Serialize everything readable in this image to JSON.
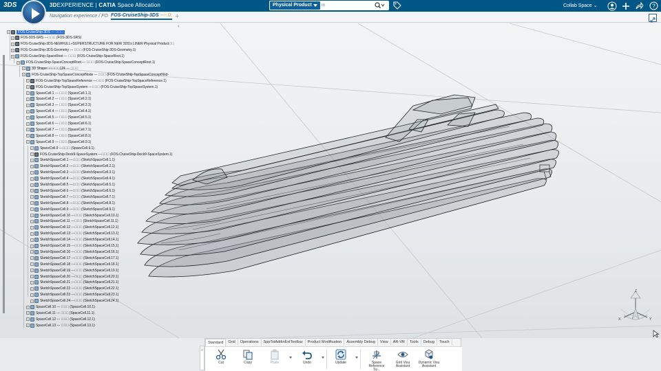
{
  "app": {
    "brand_prefix": "3D",
    "brand_experience": "EXPERIENCE",
    "brand_product": "CATIA",
    "brand_app": "Space Allocation",
    "logo_text": "3DS"
  },
  "search": {
    "scope": "Physical Product",
    "placeholder": "In"
  },
  "topbar": {
    "collab_space": "Collab Space",
    "icons": [
      "user-icon",
      "add-icon",
      "share-icon",
      "help-icon"
    ]
  },
  "tabs": {
    "nav_label": "Navigation experience / FO",
    "active_label": "FOS-CruiseShip-3DS",
    "active_suffix": "----.0:",
    "add_label": "+"
  },
  "tree": {
    "collapse_glyph": "‹",
    "nodes": [
      {
        "label": "FOS-CruiseShip-3DS --- ᷍᷍᷍",
        "level": 0,
        "icon": "prod",
        "selected": true
      },
      {
        "label": "FOS-3DS-SRS ---᷍᷍᷍ (FOS-3DS-SRS)",
        "level": 1,
        "icon": "prod"
      },
      {
        "label": "FOS-CruiseShip-3DS-NEWHULL+SUPERSTRUCTURE FOR NEW 3DS's LINER Physical Product᷍᷍",
        "level": 1,
        "icon": "prod"
      },
      {
        "label": "FOS-CruiseShip-3DS-Geometry --- ᷍᷍᷍ (FOS-CruiseShip-3DS-Geometry.1)",
        "level": 1,
        "icon": "prod"
      },
      {
        "label": "FOS-CruiseShip-SpaceRoot --- ᷍᷍᷍ (FOS-CruiseShip-SpaceRoot.1)",
        "level": 1,
        "icon": "cell"
      },
      {
        "label": "FOS-CruiseShip-SpaceConceptRoot --- ᷍᷍᷍ (FOS-CruiseShip-SpaceConceptRoot.1)",
        "level": 2,
        "icon": "cell"
      },
      {
        "label": "3D Shape᷍᷍᷍᷍᷍124 --- ᷍᷍᷍",
        "level": 3,
        "icon": "cell"
      },
      {
        "label": "FOS-CruiseShip-TopSpaceConceptNode --- ᷍᷍᷍ (FOS-CruiseShip-TopSpaceConceptNod-",
        "level": 3,
        "icon": "cell"
      },
      {
        "label": "FOS-CruiseShip-TopSpaceReference ---᷍᷍᷍ (FOS-CruiseShip-TopSpaceReference.1)",
        "level": 4,
        "icon": "prod"
      },
      {
        "label": "FOS-CruiseShip-TopSpaceSystem ---᷍᷍᷍ (FOS-CruiseShip-TopSpaceSystem.1)",
        "level": 4,
        "icon": "prod"
      },
      {
        "label": "SpaceCell.1 --- ᷍᷍᷍ (SpaceCell.1.1)",
        "level": 4,
        "icon": "cell"
      },
      {
        "label": "SpaceCell.2 --- ᷍᷍᷍ (SpaceCell.2.1)",
        "level": 4,
        "icon": "cell"
      },
      {
        "label": "SpaceCell.3 --- ᷍᷍᷍ (SpaceCell.3.1)",
        "level": 4,
        "icon": "cell"
      },
      {
        "label": "SpaceCell.4 --- ᷍᷍᷍ (SpaceCell.4.1)",
        "level": 4,
        "icon": "cell"
      },
      {
        "label": "SpaceCell.5 --- ᷍᷍᷍ (SpaceCell.5.1)",
        "level": 4,
        "icon": "cell"
      },
      {
        "label": "SpaceCell.6 --- ᷍᷍᷍ (SpaceCell.6.1)",
        "level": 4,
        "icon": "cell"
      },
      {
        "label": "SpaceCell.7 --- ᷍᷍᷍ (SpaceCell.7.1)",
        "level": 4,
        "icon": "cell"
      },
      {
        "label": "SpaceCell.8 --- ᷍᷍᷍ (SpaceCell.8.1)",
        "level": 4,
        "icon": "cell"
      },
      {
        "label": "SpaceCell.9 --- ᷍᷍᷍ (SpaceCell.9.1)",
        "level": 4,
        "icon": "cell"
      },
      {
        "label": "SpaceCell.9 ---᷍᷍᷍ (SpaceCell.9.1)",
        "level": 5,
        "icon": "cell"
      },
      {
        "label": "FOS-CruiseShip-Deck9-SpaceSystem ---᷍᷍᷍ (FOS-CruiseShip-Deck9-SpaceSystem.1)",
        "level": 5,
        "icon": "prod"
      },
      {
        "label": "SketchSpaceCell.1 ---᷍᷍᷍ (SketchSpaceCell.1.1)",
        "level": 5,
        "icon": "cell"
      },
      {
        "label": "SketchSpaceCell.2 ---᷍᷍᷍ (SketchSpaceCell.2.1)",
        "level": 5,
        "icon": "cell"
      },
      {
        "label": "SketchSpaceCell.3 ---᷍᷍᷍ (SketchSpaceCell.3.1)",
        "level": 5,
        "icon": "cell"
      },
      {
        "label": "SketchSpaceCell.4 ---᷍᷍᷍ (SketchSpaceCell.4.1)",
        "level": 5,
        "icon": "cell"
      },
      {
        "label": "SketchSpaceCell.5 ---᷍᷍᷍ (SketchSpaceCell.5.1)",
        "level": 5,
        "icon": "cell"
      },
      {
        "label": "SketchSpaceCell.6 ---᷍᷍᷍ (SketchSpaceCell.6.1)",
        "level": 5,
        "icon": "cell"
      },
      {
        "label": "SketchSpaceCell.7 ---᷍᷍᷍ (SketchSpaceCell.7.1)",
        "level": 5,
        "icon": "cell"
      },
      {
        "label": "SketchSpaceCell.8 ---᷍᷍᷍ (SketchSpaceCell.8.1)",
        "level": 5,
        "icon": "cell"
      },
      {
        "label": "SketchSpaceCell.9 ---᷍᷍᷍ (SketchSpaceCell.9.1)",
        "level": 5,
        "icon": "cell"
      },
      {
        "label": "SketchSpaceCell.10 ---᷍᷍᷍ (SketchSpaceCell.10.1)",
        "level": 5,
        "icon": "cell"
      },
      {
        "label": "SketchSpaceCell.11 ---᷍᷍᷍ (SketchSpaceCell.11.1)",
        "level": 5,
        "icon": "cell"
      },
      {
        "label": "SketchSpaceCell.12 ---᷍᷍᷍ (SketchSpaceCell.12.1)",
        "level": 5,
        "icon": "cell"
      },
      {
        "label": "SketchSpaceCell.13 ---᷍᷍᷍ (SketchSpaceCell.13.1)",
        "level": 5,
        "icon": "cell"
      },
      {
        "label": "SketchSpaceCell.14 ---᷍᷍᷍ (SketchSpaceCell.14.1)",
        "level": 5,
        "icon": "cell"
      },
      {
        "label": "SketchSpaceCell.15 ---᷍᷍᷍ (SketchSpaceCell.15.1)",
        "level": 5,
        "icon": "cell"
      },
      {
        "label": "SketchSpaceCell.16 ---᷍᷍᷍ (SketchSpaceCell.16.1)",
        "level": 5,
        "icon": "cell"
      },
      {
        "label": "SketchSpaceCell.17 ---᷍᷍᷍ (SketchSpaceCell.17.1)",
        "level": 5,
        "icon": "cell"
      },
      {
        "label": "SketchSpaceCell.18 ---᷍᷍᷍ (SketchSpaceCell.18.1)",
        "level": 5,
        "icon": "cell"
      },
      {
        "label": "SketchSpaceCell.19 ---᷍᷍᷍ (SketchSpaceCell.19.1)",
        "level": 5,
        "icon": "cell"
      },
      {
        "label": "SketchSpaceCell.20 ---᷍᷍᷍ (SketchSpaceCell.20.1)",
        "level": 5,
        "icon": "cell"
      },
      {
        "label": "SketchSpaceCell.21 ---᷍᷍᷍ (SketchSpaceCell.21.1)",
        "level": 5,
        "icon": "cell"
      },
      {
        "label": "SketchSpaceCell.22 ---᷍᷍᷍ (SketchSpaceCell.22.1)",
        "level": 5,
        "icon": "cell"
      },
      {
        "label": "SketchSpaceCell.23 ---᷍᷍᷍ (SketchSpaceCell.23.1)",
        "level": 5,
        "icon": "cell"
      },
      {
        "label": "SketchSpaceCell.24 ---᷍᷍᷍ (SketchSpaceCell.24.1)",
        "level": 5,
        "icon": "cell"
      },
      {
        "label": "SpaceCell.10 --- ᷍᷍᷍ (SpaceCell.10.1)",
        "level": 4,
        "icon": "cell"
      },
      {
        "label": "SpaceCell.11 --- ᷍᷍᷍ (SpaceCell.11.1)",
        "level": 4,
        "icon": "cell"
      },
      {
        "label": "SpaceCell.12 --- ᷍᷍᷍ (SpaceCell.12.1)",
        "level": 4,
        "icon": "cell"
      },
      {
        "label": "SpaceCell.13 --- ᷍᷍᷍ (SpaceCell.13.1)",
        "level": 4,
        "icon": "cell"
      }
    ]
  },
  "compass": {
    "z": "Z",
    "x": "X",
    "y": "Y"
  },
  "actionbar": {
    "tabs": [
      "Standard",
      "Grid",
      "Operations",
      "SppTstAddinExtToolbar",
      "Product Modification",
      "Assembly Debug",
      "View",
      "AR-VR",
      "Tools",
      "Debug",
      "Touch"
    ],
    "active_tab": "Standard",
    "side_glyph": "⌄",
    "commands": [
      {
        "label": "Cut",
        "icon": "scissors-icon",
        "disabled": false
      },
      {
        "label": "Copy",
        "icon": "copy-icon",
        "disabled": false
      },
      {
        "label": "Paste",
        "icon": "paste-icon",
        "disabled": true
      },
      {
        "label": "Undo",
        "icon": "undo-icon",
        "disabled": false
      },
      {
        "label": "Update",
        "icon": "update-icon",
        "disabled": false
      },
      {
        "label": "Space Reference Sy...",
        "icon": "space-reference-icon",
        "disabled": false
      },
      {
        "label": "Grid Visu Assistant",
        "icon": "grid-visu-icon",
        "disabled": false
      },
      {
        "label": "Dynamic Visu Assistant",
        "icon": "dynamic-visu-icon",
        "disabled": false
      }
    ]
  },
  "colors": {
    "topbar": "#005686",
    "selection": "#2e6fd1",
    "ship_fill": "#8e959b",
    "ship_stroke": "#1e2226"
  }
}
